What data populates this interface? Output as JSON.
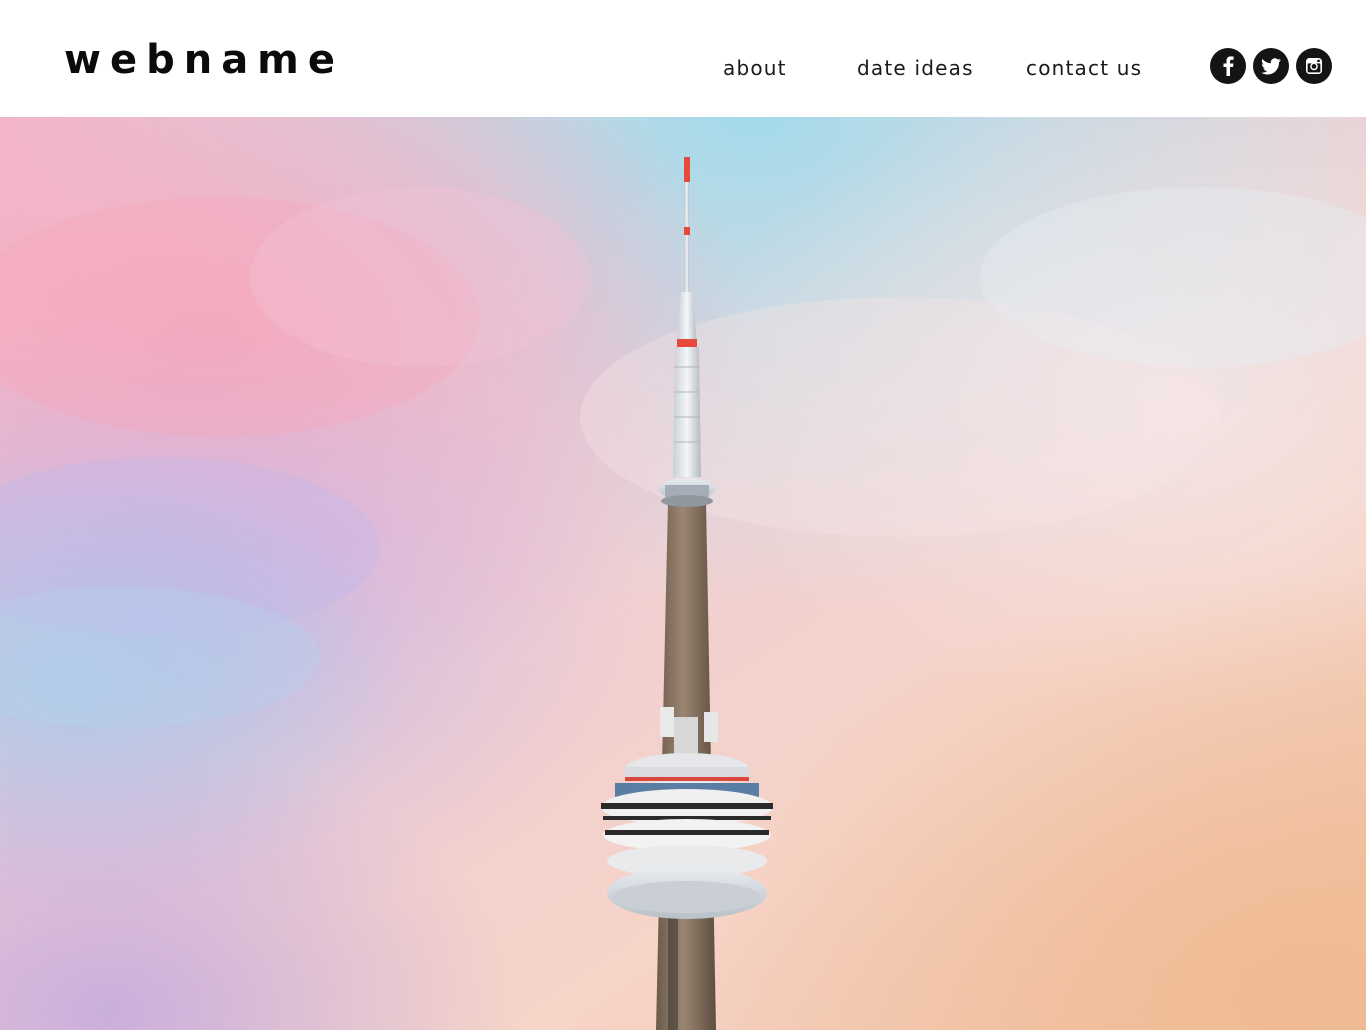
{
  "site": {
    "logo": "webname"
  },
  "nav": {
    "items": [
      {
        "label": "about"
      },
      {
        "label": "date ideas"
      },
      {
        "label": "contact us"
      }
    ]
  },
  "social": {
    "icons": [
      "facebook-icon",
      "twitter-icon",
      "instagram-icon"
    ],
    "background_color": "#141414",
    "icon_color": "#ffffff"
  },
  "hero": {
    "image": "pastel-sky-with-tower",
    "sky_colors": [
      "#f4b3c2",
      "#c9b3e6",
      "#a9dbe8",
      "#f6d6c8",
      "#f1c3a3"
    ]
  }
}
